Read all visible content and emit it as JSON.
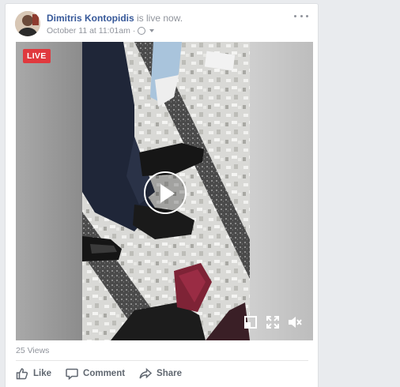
{
  "post": {
    "author": "Dimitris Kontopidis",
    "action_text": " is live now.",
    "date": "October 11 at 11:01am",
    "date_separator": "·",
    "privacy_icon": "globe-icon",
    "menu_icon": "more-options-icon"
  },
  "video": {
    "live_badge": "LIVE",
    "play_icon": "play-icon",
    "controls": [
      {
        "icon": "mini-player-icon"
      },
      {
        "icon": "fullscreen-icon"
      },
      {
        "icon": "mute-icon"
      }
    ]
  },
  "stats": {
    "views": "25 Views"
  },
  "actions": [
    {
      "label": "Like",
      "icon": "thumbs-up-icon"
    },
    {
      "label": "Comment",
      "icon": "comment-icon"
    },
    {
      "label": "Share",
      "icon": "share-icon"
    }
  ],
  "colors": {
    "author_link": "#365899",
    "live_red": "#e0393e",
    "secondary_text": "#90949c",
    "page_background": "#e9ebee"
  }
}
